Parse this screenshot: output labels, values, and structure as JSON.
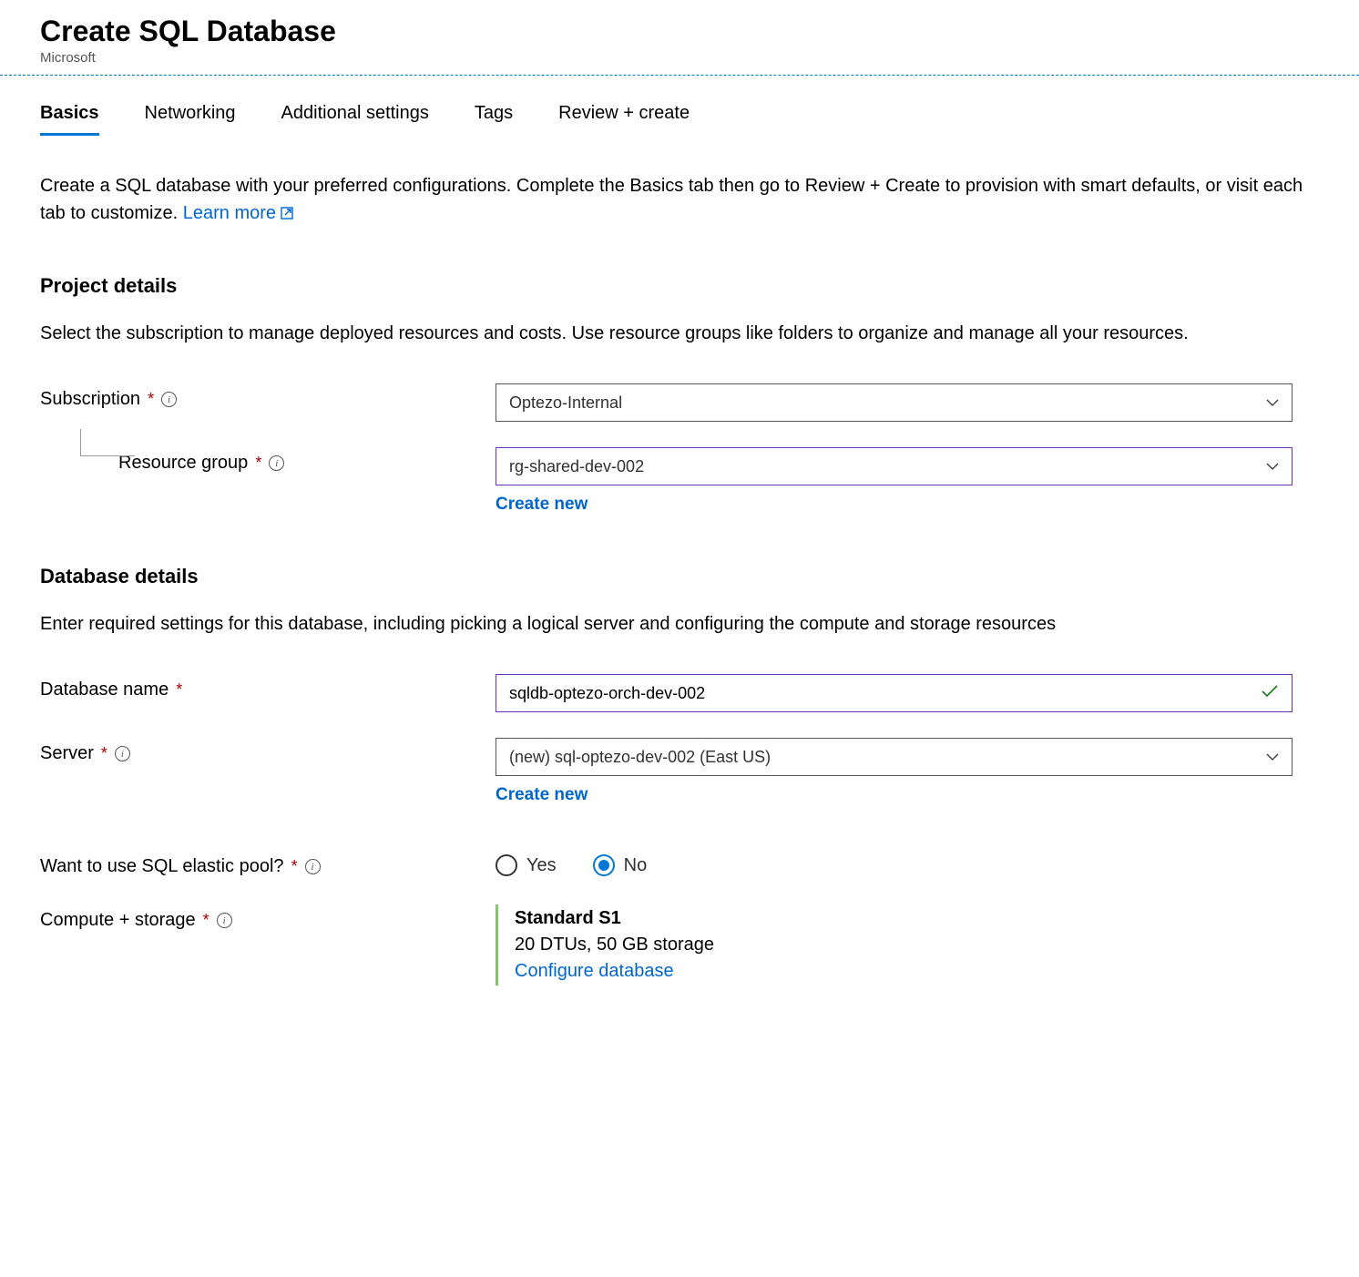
{
  "header": {
    "title": "Create SQL Database",
    "subtitle": "Microsoft"
  },
  "tabs": [
    {
      "label": "Basics",
      "active": true
    },
    {
      "label": "Networking",
      "active": false
    },
    {
      "label": "Additional settings",
      "active": false
    },
    {
      "label": "Tags",
      "active": false
    },
    {
      "label": "Review + create",
      "active": false
    }
  ],
  "intro": {
    "text": "Create a SQL database with your preferred configurations. Complete the Basics tab then go to Review + Create to provision with smart defaults, or visit each tab to customize. ",
    "link_text": "Learn more"
  },
  "project_details": {
    "title": "Project details",
    "desc": "Select the subscription to manage deployed resources and costs. Use resource groups like folders to organize and manage all your resources.",
    "subscription_label": "Subscription",
    "subscription_value": "Optezo-Internal",
    "resource_group_label": "Resource group",
    "resource_group_value": "rg-shared-dev-002",
    "create_new": "Create new"
  },
  "database_details": {
    "title": "Database details",
    "desc": "Enter required settings for this database, including picking a logical server and configuring the compute and storage resources",
    "db_name_label": "Database name",
    "db_name_value": "sqldb-optezo-orch-dev-002",
    "server_label": "Server",
    "server_value": "(new) sql-optezo-dev-002 (East US)",
    "create_new": "Create new",
    "elastic_pool_label": "Want to use SQL elastic pool?",
    "elastic_yes": "Yes",
    "elastic_no": "No",
    "compute_label": "Compute + storage",
    "compute_tier": "Standard S1",
    "compute_detail": "20 DTUs, 50 GB storage",
    "configure_link": "Configure database"
  }
}
